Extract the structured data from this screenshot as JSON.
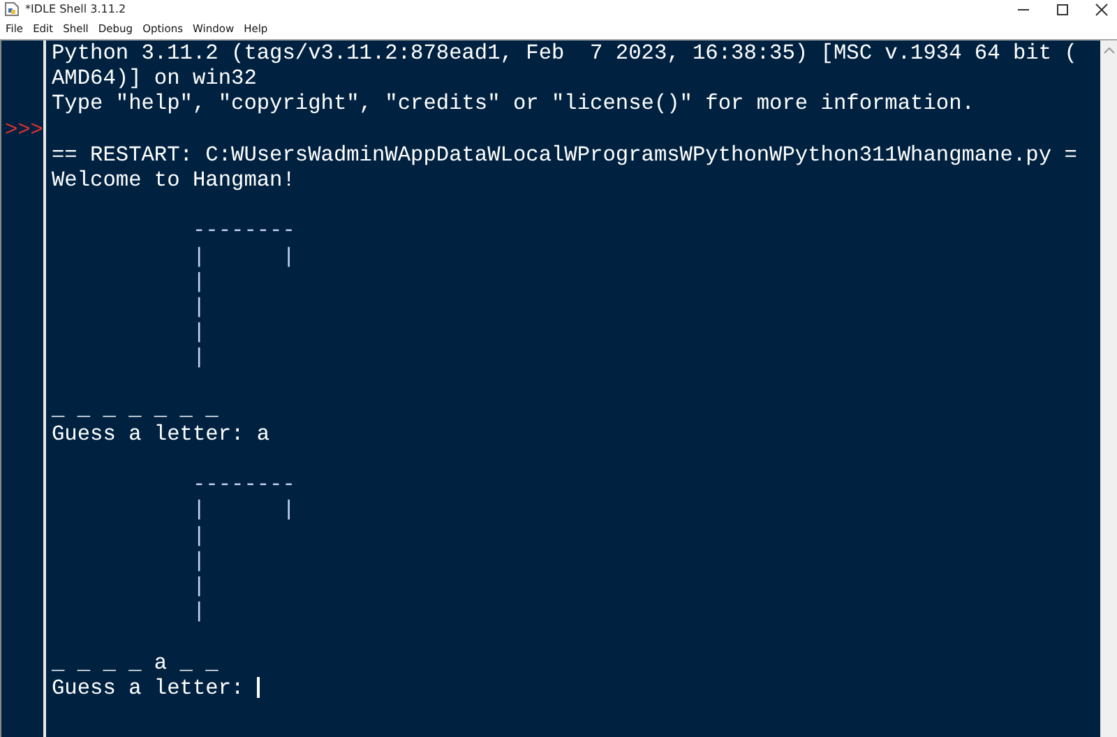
{
  "window": {
    "title": "*IDLE Shell 3.11.2"
  },
  "menu": [
    "File",
    "Edit",
    "Shell",
    "Debug",
    "Options",
    "Window",
    "Help"
  ],
  "shell": {
    "lines": [
      {
        "kind": "output",
        "text": "Python 3.11.2 (tags/v3.11.2:878ead1, Feb  7 2023, 16:38:35) [MSC v.1934 64 bit ("
      },
      {
        "kind": "output",
        "text": "AMD64)] on win32"
      },
      {
        "kind": "output",
        "text": "Type \"help\", \"copyright\", \"credits\" or \"license()\" for more information."
      },
      {
        "kind": "blank",
        "prompt": ">>>"
      },
      {
        "kind": "output",
        "text": "== RESTART: C:WUsersWadminWAppDataWLocalWProgramsWPythonWPython311Whangmane.py ="
      },
      {
        "kind": "output",
        "text": "Welcome to Hangman!"
      },
      {
        "kind": "blank"
      },
      {
        "kind": "art",
        "text": "           --------"
      },
      {
        "kind": "art",
        "text": "           |      |"
      },
      {
        "kind": "art",
        "text": "           |"
      },
      {
        "kind": "art",
        "text": "           |"
      },
      {
        "kind": "art",
        "text": "           |"
      },
      {
        "kind": "art",
        "text": "           |"
      },
      {
        "kind": "blank"
      },
      {
        "kind": "output",
        "text": "_ _ _ _ _ _ _"
      },
      {
        "kind": "output",
        "text": "Guess a letter: a"
      },
      {
        "kind": "blank"
      },
      {
        "kind": "art",
        "text": "           --------"
      },
      {
        "kind": "art",
        "text": "           |      |"
      },
      {
        "kind": "art",
        "text": "           |"
      },
      {
        "kind": "art",
        "text": "           |"
      },
      {
        "kind": "art",
        "text": "           |"
      },
      {
        "kind": "art",
        "text": "           |"
      },
      {
        "kind": "blank"
      },
      {
        "kind": "output",
        "text": "_ _ _ _ a _ _"
      },
      {
        "kind": "output",
        "text": "Guess a letter: ",
        "cursor": true
      }
    ]
  }
}
